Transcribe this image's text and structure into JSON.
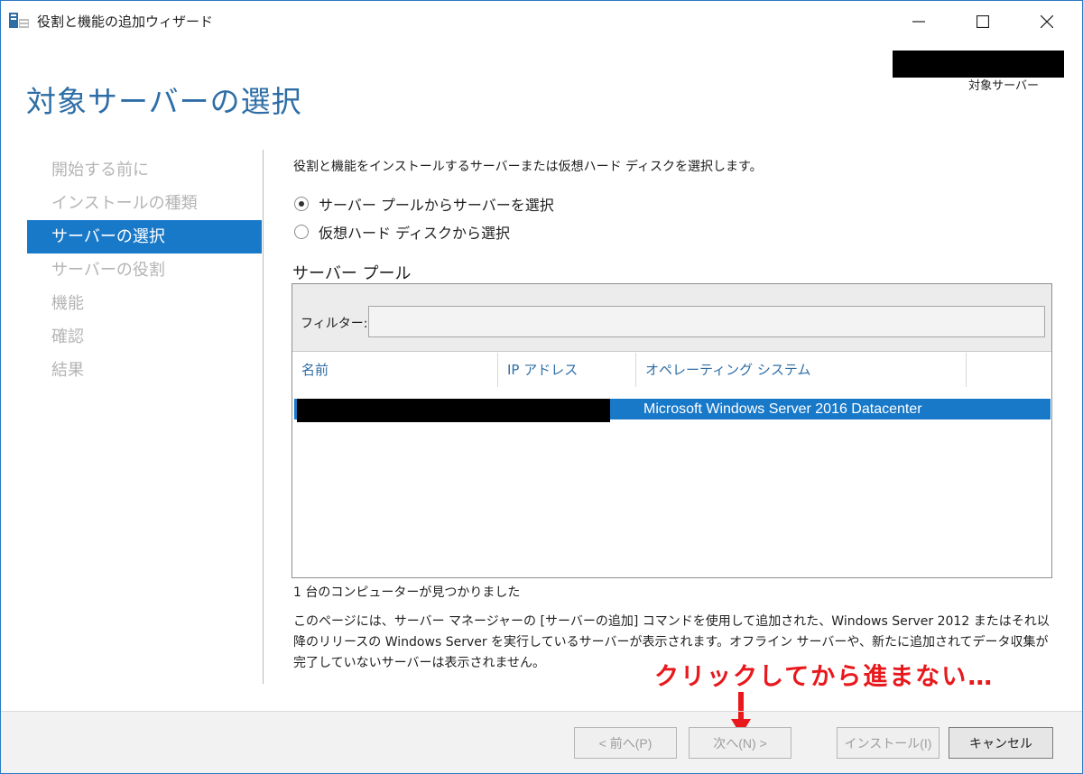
{
  "window": {
    "title": "役割と機能の追加ウィザード",
    "accent_color": "#1979c9"
  },
  "header": {
    "page_title": "対象サーバーの選択",
    "target_label": "対象サーバー"
  },
  "nav": {
    "items": [
      {
        "label": "開始する前に",
        "state": "disabled"
      },
      {
        "label": "インストールの種類",
        "state": "disabled"
      },
      {
        "label": "サーバーの選択",
        "state": "active"
      },
      {
        "label": "サーバーの役割",
        "state": "disabled"
      },
      {
        "label": "機能",
        "state": "disabled"
      },
      {
        "label": "確認",
        "state": "disabled"
      },
      {
        "label": "結果",
        "state": "disabled"
      }
    ]
  },
  "main": {
    "description": "役割と機能をインストールするサーバーまたは仮想ハード ディスクを選択します。",
    "options": [
      {
        "label": "サーバー プールからサーバーを選択",
        "checked": true
      },
      {
        "label": "仮想ハード ディスクから選択",
        "checked": false
      }
    ],
    "pool_heading": "サーバー プール",
    "filter_label": "フィルター:",
    "filter_value": "",
    "columns": [
      "名前",
      "IP アドレス",
      "オペレーティング システム"
    ],
    "rows": [
      {
        "os": "Microsoft Windows Server 2016 Datacenter",
        "selected": true
      }
    ],
    "count_text": "1 台のコンピューターが見つかりました",
    "info_text": "このページには、サーバー マネージャーの [サーバーの追加] コマンドを使用して追加された、Windows Server 2012 またはそれ以降のリリースの Windows Server を実行しているサーバーが表示されます。オフライン サーバーや、新たに追加されてデータ収集が完了していないサーバーは表示されません。"
  },
  "annotation": {
    "text": "クリックしてから進まない…",
    "color": "#e8181c"
  },
  "footer": {
    "prev": "< 前へ(P)",
    "next": "次へ(N) >",
    "install": "インストール(I)",
    "cancel": "キャンセル"
  }
}
